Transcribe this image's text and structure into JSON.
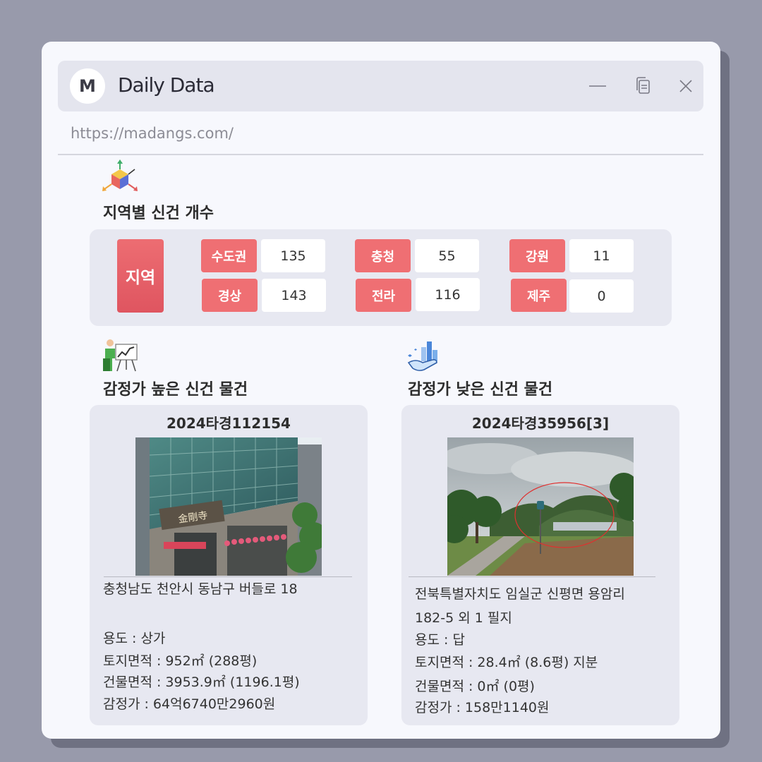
{
  "window": {
    "logo_letter": "M",
    "title": "Daily Data",
    "url": "https://madangs.com/"
  },
  "icons": {
    "titlebar": [
      "minimize-icon",
      "copy-icon",
      "close-icon"
    ],
    "section1": "3d-axis-cube-icon",
    "section2": "presentation-chart-icon",
    "section3": "hand-bar-chart-icon"
  },
  "region_section": {
    "heading": "지역별 신건 개수",
    "label": "지역",
    "regions": [
      {
        "name": "수도권",
        "count": "135"
      },
      {
        "name": "경상",
        "count": "143"
      },
      {
        "name": "충청",
        "count": "55"
      },
      {
        "name": "전라",
        "count": "116"
      },
      {
        "name": "강원",
        "count": "11"
      },
      {
        "name": "제주",
        "count": "0"
      }
    ]
  },
  "high_section": {
    "heading": "감정가 높은 신건 물건",
    "case_no": "2024타경112154",
    "address": "충청남도 천안시 동남구 버들로 18",
    "usage": "용도 : 상가",
    "land_area": "토지면적 : 952㎡ (288평)",
    "building_area": "건물면적 : 3953.9㎡ (1196.1평)",
    "appraisal": "감정가 : 64억6740만2960원",
    "photo_sign": "金剛寺"
  },
  "low_section": {
    "heading": "감정가 낮은 신건 물건",
    "case_no": "2024타경35956[3]",
    "address_line1": "전북특별자치도 임실군 신평면 용암리",
    "address_line2": "182-5 외 1 필지",
    "usage": "용도 : 답",
    "land_area": "토지면적 : 28.4㎡ (8.6평) 지분",
    "building_area": "건물면적 : 0㎡ (0평)",
    "appraisal": "감정가 : 158만1140원"
  },
  "colors": {
    "accent": "#ef6f73",
    "panel": "#e7e8f1",
    "window": "#f7f8fd",
    "backdrop": "#989aab"
  }
}
